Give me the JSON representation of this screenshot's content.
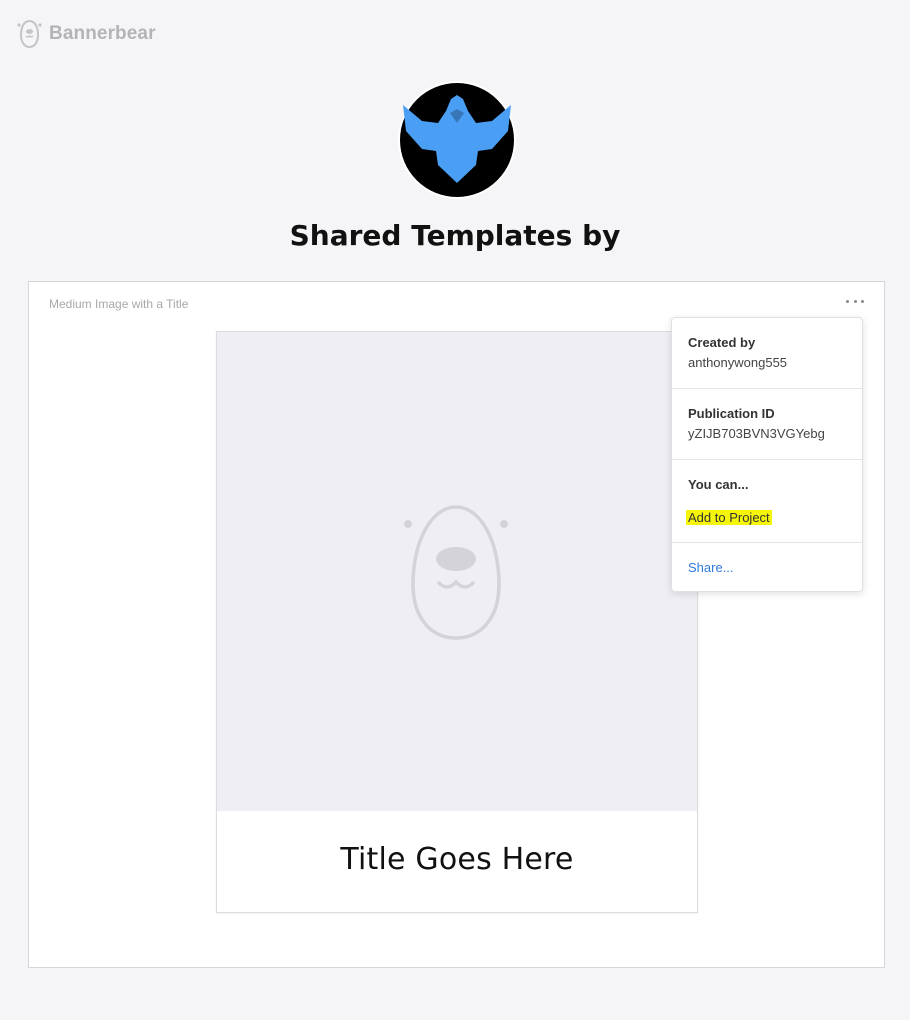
{
  "brand": {
    "name": "Bannerbear"
  },
  "page": {
    "title": "Shared Templates by"
  },
  "template": {
    "label": "Medium Image with a Title",
    "preview_title": "Title Goes Here"
  },
  "menu": {
    "created_by_heading": "Created by",
    "created_by_value": "anthonywong555",
    "publication_id_heading": "Publication ID",
    "publication_id_value": "yZIJB703BVN3VGYebg",
    "you_can_heading": "You can...",
    "add_to_project": "Add to Project",
    "share": "Share..."
  },
  "colors": {
    "background": "#f5f5f7",
    "avatar_bg": "#000000",
    "avatar_emblem": "#4a9ff5",
    "highlight": "#f5f50a",
    "link": "#2f7ce0"
  },
  "icons": {
    "logo": "bear-logo-icon",
    "avatar": "bird-emblem-icon",
    "more": "more-options-icon",
    "placeholder": "bear-placeholder-icon"
  }
}
